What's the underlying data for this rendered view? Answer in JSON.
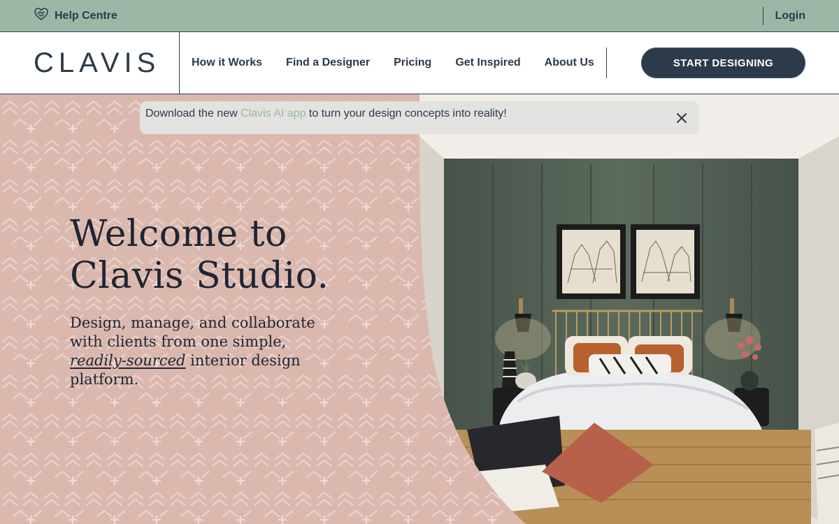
{
  "utility_bar": {
    "help_label": "Help Centre",
    "help_icon": "handshake-heart-icon",
    "login_label": "Login"
  },
  "nav": {
    "logo": "CLAVIS",
    "links": [
      "How it Works",
      "Find a Designer",
      "Pricing",
      "Get Inspired",
      "About Us"
    ],
    "cta_label": "START DESIGNING"
  },
  "announcement": {
    "prefix": "Download the new ",
    "link_text": "Clavis AI app",
    "suffix": " to turn your design concepts into reality!",
    "close_icon": "close-icon"
  },
  "hero": {
    "title_line1": "Welcome to",
    "title_line2": "Clavis Studio.",
    "subtitle_part1": "Design, manage, and collaborate with clients from one simple, ",
    "subtitle_emphasis": "readily-sourced",
    "subtitle_part2": " interior design platform."
  },
  "colors": {
    "sage": "#9db7a6",
    "navy": "#2c3a4a",
    "blush": "#dbb8ae"
  }
}
